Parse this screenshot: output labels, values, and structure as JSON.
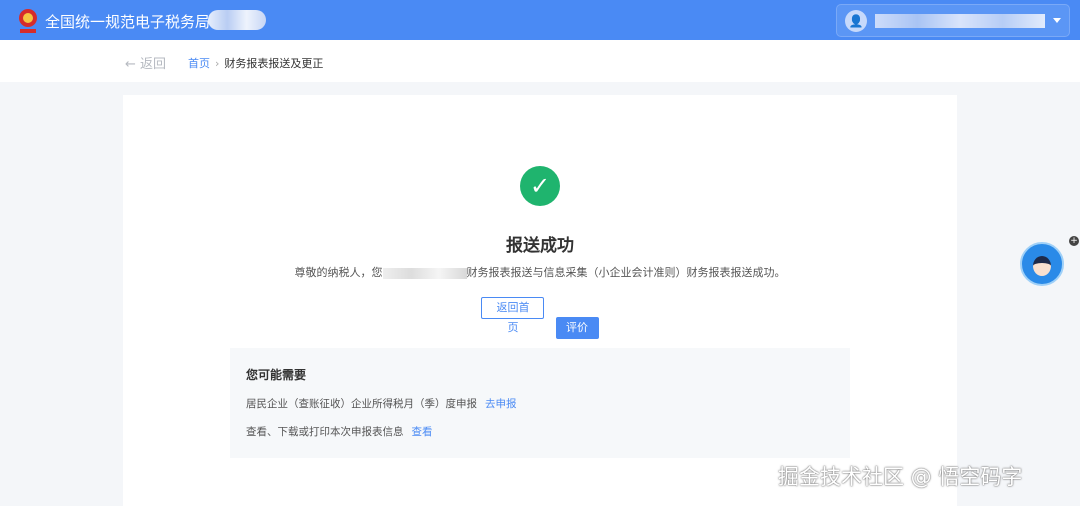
{
  "header": {
    "title": "全国统一规范电子税务局"
  },
  "breadcrumb": {
    "back": "← 返回",
    "home": "首页",
    "sep": "›",
    "current": "财务报表报送及更正"
  },
  "result": {
    "icon": "✓",
    "title": "报送成功",
    "msg_prefix": "尊敬的纳税人，您",
    "msg_suffix": "财务报表报送与信息采集（小企业会计准则）财务报表报送成功。",
    "home_button": "返回首页",
    "rate_button": "评价"
  },
  "needs": {
    "title": "您可能需要",
    "items": [
      {
        "text": "居民企业（查账征收）企业所得税月（季）度申报",
        "link": "去申报"
      },
      {
        "text": "查看、下载或打印本次申报表信息",
        "link": "查看"
      }
    ]
  },
  "float": {
    "plus": "+"
  },
  "watermark": "掘金技术社区 @ 悟空码字"
}
